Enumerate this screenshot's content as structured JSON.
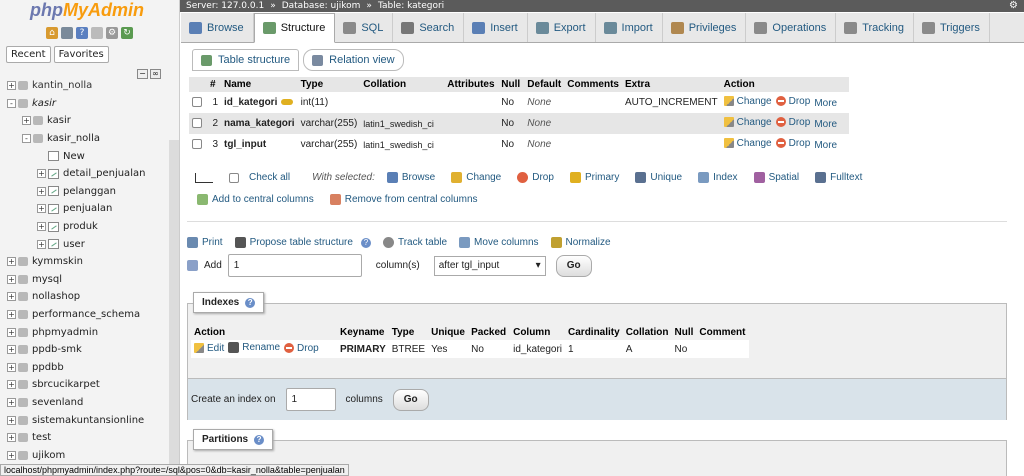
{
  "app": {
    "logo_php": "php",
    "logo_myadmin": "MyAdmin"
  },
  "nav": {
    "tabs": [
      "Recent",
      "Favorites"
    ],
    "tree": [
      {
        "label": "kantin_nolla",
        "level": 0,
        "type": "db",
        "pm": "+"
      },
      {
        "label": "kasir",
        "level": 0,
        "type": "db",
        "pm": "-",
        "italic": true
      },
      {
        "label": "kasir",
        "level": 1,
        "type": "db",
        "pm": "+"
      },
      {
        "label": "kasir_nolla",
        "level": 1,
        "type": "db",
        "pm": "-"
      },
      {
        "label": "New",
        "level": 2,
        "type": "new",
        "pm": ""
      },
      {
        "label": "detail_penjualan",
        "level": 2,
        "type": "table",
        "pm": "+"
      },
      {
        "label": "pelanggan",
        "level": 2,
        "type": "table",
        "pm": "+"
      },
      {
        "label": "penjualan",
        "level": 2,
        "type": "table",
        "pm": "+"
      },
      {
        "label": "produk",
        "level": 2,
        "type": "table",
        "pm": "+"
      },
      {
        "label": "user",
        "level": 2,
        "type": "table",
        "pm": "+"
      },
      {
        "label": "kymmskin",
        "level": 0,
        "type": "db",
        "pm": "+"
      },
      {
        "label": "mysql",
        "level": 0,
        "type": "db",
        "pm": "+"
      },
      {
        "label": "nollashop",
        "level": 0,
        "type": "db",
        "pm": "+"
      },
      {
        "label": "performance_schema",
        "level": 0,
        "type": "db",
        "pm": "+"
      },
      {
        "label": "phpmyadmin",
        "level": 0,
        "type": "db",
        "pm": "+"
      },
      {
        "label": "ppdb-smk",
        "level": 0,
        "type": "db",
        "pm": "+"
      },
      {
        "label": "ppdbb",
        "level": 0,
        "type": "db",
        "pm": "+"
      },
      {
        "label": "sbrcucikarpet",
        "level": 0,
        "type": "db",
        "pm": "+"
      },
      {
        "label": "sevenland",
        "level": 0,
        "type": "db",
        "pm": "+"
      },
      {
        "label": "sistemakuntansionline",
        "level": 0,
        "type": "db",
        "pm": "+"
      },
      {
        "label": "test",
        "level": 0,
        "type": "db",
        "pm": "+"
      },
      {
        "label": "ujikom",
        "level": 0,
        "type": "db",
        "pm": "+"
      }
    ]
  },
  "breadcrumb": {
    "server": "Server: 127.0.0.1",
    "sep": "»",
    "database": "Database: ujikom",
    "table": "Table: kategori"
  },
  "tabs": [
    {
      "label": "Browse",
      "icon": "browse-icon",
      "color": "#5a7fb5"
    },
    {
      "label": "Structure",
      "icon": "structure-icon",
      "color": "#6a9a6a",
      "active": true
    },
    {
      "label": "SQL",
      "icon": "sql-icon",
      "color": "#8a8a8a"
    },
    {
      "label": "Search",
      "icon": "search-icon",
      "color": "#777"
    },
    {
      "label": "Insert",
      "icon": "insert-icon",
      "color": "#5a7fb5"
    },
    {
      "label": "Export",
      "icon": "export-icon",
      "color": "#6a8a9a"
    },
    {
      "label": "Import",
      "icon": "import-icon",
      "color": "#6a8a9a"
    },
    {
      "label": "Privileges",
      "icon": "privileges-icon",
      "color": "#b08850"
    },
    {
      "label": "Operations",
      "icon": "operations-icon",
      "color": "#8a8a8a"
    },
    {
      "label": "Tracking",
      "icon": "tracking-icon",
      "color": "#8a8a8a"
    },
    {
      "label": "Triggers",
      "icon": "triggers-icon",
      "color": "#8a8a8a"
    }
  ],
  "subtabs": {
    "table_structure": "Table structure",
    "relation_view": "Relation view"
  },
  "structure": {
    "headers": [
      "#",
      "Name",
      "Type",
      "Collation",
      "Attributes",
      "Null",
      "Default",
      "Comments",
      "Extra",
      "Action"
    ],
    "rows": [
      {
        "num": "1",
        "name": "id_kategori",
        "primary_key": true,
        "type": "int(11)",
        "collation": "",
        "attributes": "",
        "null": "No",
        "default": "None",
        "comments": "",
        "extra": "AUTO_INCREMENT"
      },
      {
        "num": "2",
        "name": "nama_kategori",
        "primary_key": false,
        "type": "varchar(255)",
        "collation": "latin1_swedish_ci",
        "attributes": "",
        "null": "No",
        "default": "None",
        "comments": "",
        "extra": ""
      },
      {
        "num": "3",
        "name": "tgl_input",
        "primary_key": false,
        "type": "varchar(255)",
        "collation": "latin1_swedish_ci",
        "attributes": "",
        "null": "No",
        "default": "None",
        "comments": "",
        "extra": ""
      }
    ],
    "actions": {
      "change": "Change",
      "drop": "Drop",
      "more": "More"
    }
  },
  "with_selected": {
    "check_all": "Check all",
    "label": "With selected:",
    "items": [
      "Browse",
      "Change",
      "Drop",
      "Primary",
      "Unique",
      "Index",
      "Spatial",
      "Fulltext"
    ],
    "add_central": "Add to central columns",
    "remove_central": "Remove from central columns"
  },
  "tools": {
    "print": "Print",
    "propose": "Propose table structure",
    "track": "Track table",
    "move": "Move columns",
    "normalize": "Normalize"
  },
  "add_columns": {
    "label": "Add",
    "count": "1",
    "unit": "column(s)",
    "position": "after tgl_input",
    "go": "Go"
  },
  "indexes": {
    "title": "Indexes",
    "headers": [
      "Action",
      "Keyname",
      "Type",
      "Unique",
      "Packed",
      "Column",
      "Cardinality",
      "Collation",
      "Null",
      "Comment"
    ],
    "rows": [
      {
        "keyname": "PRIMARY",
        "type": "BTREE",
        "unique": "Yes",
        "packed": "No",
        "column": "id_kategori",
        "cardinality": "1",
        "collation": "A",
        "null": "No",
        "comment": ""
      }
    ],
    "actions": {
      "edit": "Edit",
      "rename": "Rename",
      "drop": "Drop"
    },
    "create_label": "Create an index on",
    "create_count": "1",
    "create_unit": "columns",
    "go": "Go"
  },
  "partitions": {
    "title": "Partitions"
  },
  "statusbar": "localhost/phpmyadmin/index.php?route=/sql&pos=0&db=kasir_nolla&table=penjualan"
}
